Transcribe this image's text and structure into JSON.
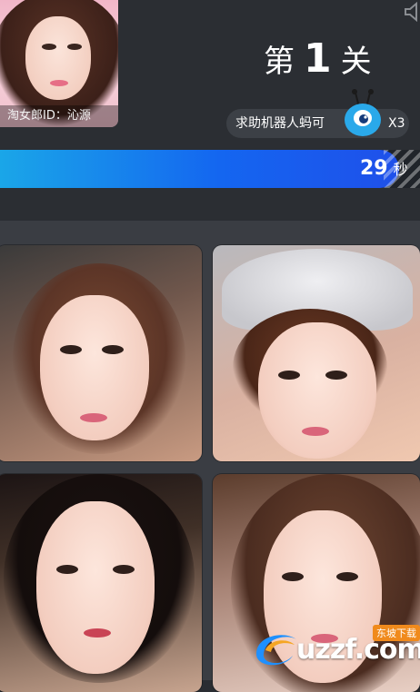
{
  "header": {
    "reference_caption": "淘女郎ID：沁源",
    "level": {
      "prefix": "第",
      "number": "1",
      "suffix": "关"
    },
    "helper": {
      "label": "求助机器人蚂可",
      "count": "X3"
    },
    "timer": {
      "seconds": "29",
      "unit": "秒",
      "progress": 0.95
    }
  },
  "choices": [
    {
      "icon": "photo-choice-1"
    },
    {
      "icon": "photo-choice-2"
    },
    {
      "icon": "photo-choice-3"
    },
    {
      "icon": "photo-choice-4"
    }
  ],
  "watermark": {
    "brand": "uzzf.com",
    "sub": "东坡下载"
  },
  "colors": {
    "accent": "#1466f0",
    "background": "#2b2e33",
    "grid": "#3a3d43"
  }
}
